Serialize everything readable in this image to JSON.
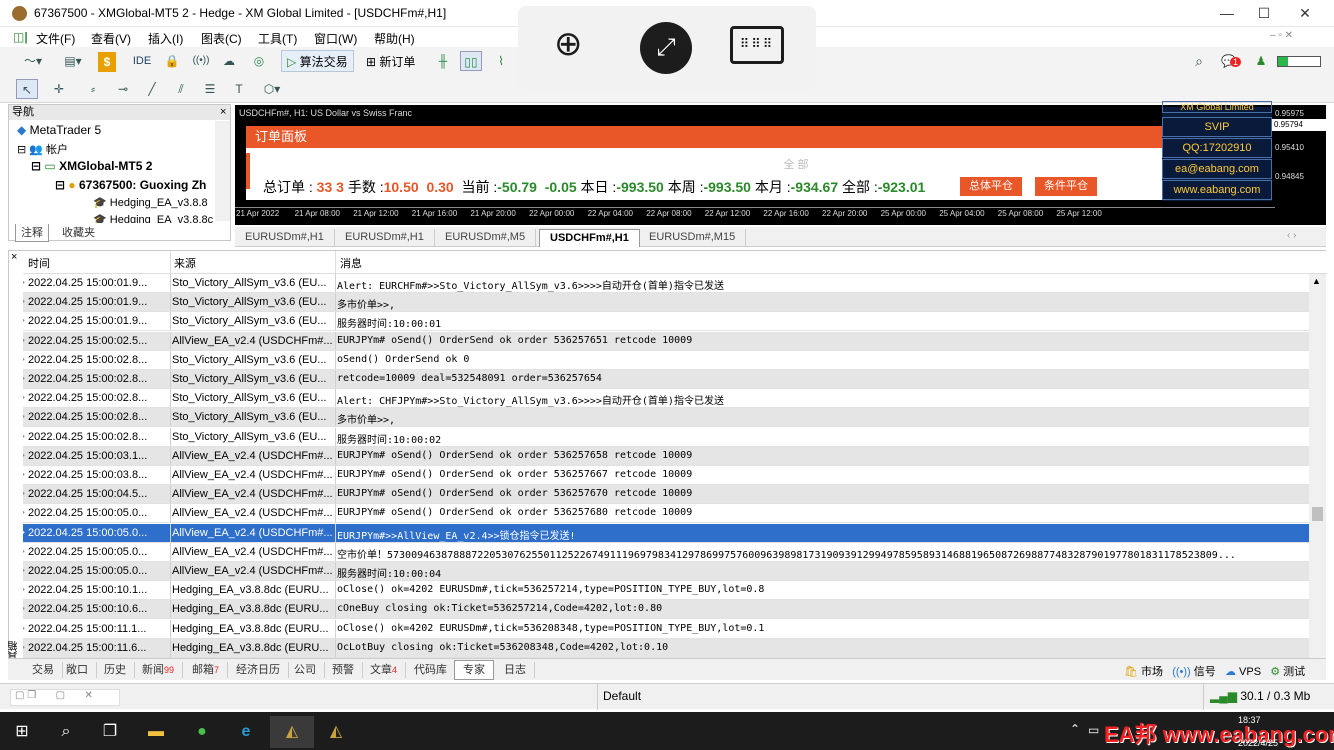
{
  "window": {
    "title": "67367500 - XMGlobal-MT5 2 - Hedge - XM Global Limited - [USDCHFm#,H1]",
    "minimize": "—",
    "maximize": "☐",
    "close": "✕"
  },
  "menu": [
    "文件(F)",
    "查看(V)",
    "插入(I)",
    "图表(C)",
    "工具(T)",
    "窗口(W)",
    "帮助(H)"
  ],
  "toolbar": {
    "ide": "IDE",
    "algo": "算法交易",
    "new_order": "新订单"
  },
  "navigator": {
    "title": "导航",
    "root": "MetaTrader 5",
    "accounts": "帐户",
    "server": "XMGlobal-MT5 2",
    "account": "67367500: Guoxing Zh",
    "ea1": "Hedging_EA_v3.8.8",
    "ea2": "Hedging_EA_v3.8.8c",
    "tab1": "注释",
    "tab2": "收藏夹"
  },
  "chart": {
    "symbol_label": "USDCHFm#, H1: US Dollar vs Swiss Franc",
    "time_labels": [
      "21 Apr 2022",
      "21 Apr 08:00",
      "21 Apr 12:00",
      "21 Apr 16:00",
      "21 Apr 20:00",
      "22 Apr 00:00",
      "22 Apr 04:00",
      "22 Apr 08:00",
      "22 Apr 12:00",
      "22 Apr 16:00",
      "22 Apr 20:00",
      "25 Apr 00:00",
      "25 Apr 04:00",
      "25 Apr 08:00",
      "25 Apr 12:00"
    ],
    "price_labels": [
      "0.95975",
      "0.95794",
      "0.95410",
      "0.94845"
    ],
    "promo": [
      "XM Global Limited",
      "SVIP",
      "QQ:17202910",
      "ea@eabang.com",
      "www.eabang.com"
    ]
  },
  "order_panel": {
    "title": "订单面板",
    "section": "全 部",
    "total_label": "总订单 :",
    "total1": "33",
    "total2": "3",
    "lots_label": "手数 :",
    "lots1": "10.50",
    "lots2": "0.30",
    "current_label": "当前 :",
    "current1": "-50.79",
    "current2": "-0.05",
    "today_label": "本日 :",
    "today": "-993.50",
    "week_label": "本周 :",
    "week": "-993.50",
    "month_label": "本月 :",
    "month": "-934.67",
    "all_label": "全部 :",
    "all": "-923.01",
    "btn_close_all": "总体平仓",
    "btn_cond_close": "条件平仓"
  },
  "chart_tabs": [
    "EURUSDm#,H1",
    "EURUSDm#,H1",
    "EURUSDm#,M5",
    "USDCHFm#,H1",
    "EURUSDm#,M15"
  ],
  "log": {
    "headers": [
      "时间",
      "来源",
      "消息"
    ],
    "rows": [
      [
        "2022.04.25 15:00:01.9...",
        "Sto_Victory_AllSym_v3.6 (EU...",
        "Alert: EURCHFm#>>Sto_Victory_AllSym_v3.6>>>>自动开仓(首单)指令已发送"
      ],
      [
        "2022.04.25 15:00:01.9...",
        "Sto_Victory_AllSym_v3.6 (EU...",
        "多市价单>>,"
      ],
      [
        "2022.04.25 15:00:01.9...",
        "Sto_Victory_AllSym_v3.6 (EU...",
        "服务器时间:10:00:01"
      ],
      [
        "2022.04.25 15:00:02.5...",
        "AllView_EA_v2.4 (USDCHFm#...",
        "EURJPYm# oSend() OrderSend ok order 536257651 retcode 10009"
      ],
      [
        "2022.04.25 15:00:02.8...",
        "Sto_Victory_AllSym_v3.6 (EU...",
        "oSend() OrderSend ok 0"
      ],
      [
        "2022.04.25 15:00:02.8...",
        "Sto_Victory_AllSym_v3.6 (EU...",
        "retcode=10009  deal=532548091  order=536257654"
      ],
      [
        "2022.04.25 15:00:02.8...",
        "Sto_Victory_AllSym_v3.6 (EU...",
        "Alert: CHFJPYm#>>Sto_Victory_AllSym_v3.6>>>>自动开仓(首单)指令已发送"
      ],
      [
        "2022.04.25 15:00:02.8...",
        "Sto_Victory_AllSym_v3.6 (EU...",
        "多市价单>>,"
      ],
      [
        "2022.04.25 15:00:02.8...",
        "Sto_Victory_AllSym_v3.6 (EU...",
        "服务器时间:10:00:02"
      ],
      [
        "2022.04.25 15:00:03.1...",
        "AllView_EA_v2.4 (USDCHFm#...",
        "EURJPYm# oSend() OrderSend ok order 536257658 retcode 10009"
      ],
      [
        "2022.04.25 15:00:03.8...",
        "AllView_EA_v2.4 (USDCHFm#...",
        "EURJPYm# oSend() OrderSend ok order 536257667 retcode 10009"
      ],
      [
        "2022.04.25 15:00:04.5...",
        "AllView_EA_v2.4 (USDCHFm#...",
        "EURJPYm# oSend() OrderSend ok order 536257670 retcode 10009"
      ],
      [
        "2022.04.25 15:00:05.0...",
        "AllView_EA_v2.4 (USDCHFm#...",
        "EURJPYm# oSend() OrderSend ok order 536257680 retcode 10009"
      ],
      [
        "2022.04.25 15:00:05.0...",
        "AllView_EA_v2.4 (USDCHFm#...",
        "EURJPYm#>>AllView_EA_v2.4>>锁仓指令已发送!"
      ],
      [
        "2022.04.25 15:00:05.0...",
        "AllView_EA_v2.4 (USDCHFm#...",
        "空市价单！573009463878887220530762550112522674911196979834129786997576009639898173190939129949785958931468819650872698877483287901977801831178523809..."
      ],
      [
        "2022.04.25 15:00:05.0...",
        "AllView_EA_v2.4 (USDCHFm#...",
        "服务器时间:10:00:04"
      ],
      [
        "2022.04.25 15:00:10.1...",
        "Hedging_EA_v3.8.8dc (EURU...",
        "oClose() ok=4202 EURUSDm#,tick=536257214,type=POSITION_TYPE_BUY,lot=0.8"
      ],
      [
        "2022.04.25 15:00:10.6...",
        "Hedging_EA_v3.8.8dc (EURU...",
        "cOneBuy closing ok:Ticket=536257214,Code=4202,lot:0.80"
      ],
      [
        "2022.04.25 15:00:11.1...",
        "Hedging_EA_v3.8.8dc (EURU...",
        "oClose() ok=4202 EURUSDm#,tick=536208348,type=POSITION_TYPE_BUY,lot=0.1"
      ],
      [
        "2022.04.25 15:00:11.6...",
        "Hedging_EA_v3.8.8dc (EURU...",
        "OcLotBuy closing ok:Ticket=536208348,Code=4202,lot:0.10"
      ]
    ],
    "selected_index": 13
  },
  "bottom_tabs": [
    {
      "label": "交易",
      "badge": ""
    },
    {
      "label": "敞口",
      "badge": ""
    },
    {
      "label": "历史",
      "badge": ""
    },
    {
      "label": "新闻",
      "badge": "99"
    },
    {
      "label": "邮箱",
      "badge": "7"
    },
    {
      "label": "经济日历",
      "badge": ""
    },
    {
      "label": "公司",
      "badge": ""
    },
    {
      "label": "预警",
      "badge": ""
    },
    {
      "label": "文章",
      "badge": "4"
    },
    {
      "label": "代码库",
      "badge": ""
    },
    {
      "label": "专家",
      "badge": ""
    },
    {
      "label": "日志",
      "badge": ""
    }
  ],
  "bottom_right": {
    "market": "市场",
    "signals": "信号",
    "vps": "VPS",
    "tester": "测试"
  },
  "toolbox_side_label": "工具箱",
  "status": {
    "profile": "Default",
    "traffic": "30.1 / 0.3 Mb"
  },
  "notification_count": "1",
  "watermark": {
    "prefix": "EA邦",
    "site": "www.eabang.com",
    "time": "18:37",
    "date": "2022/4/25"
  }
}
